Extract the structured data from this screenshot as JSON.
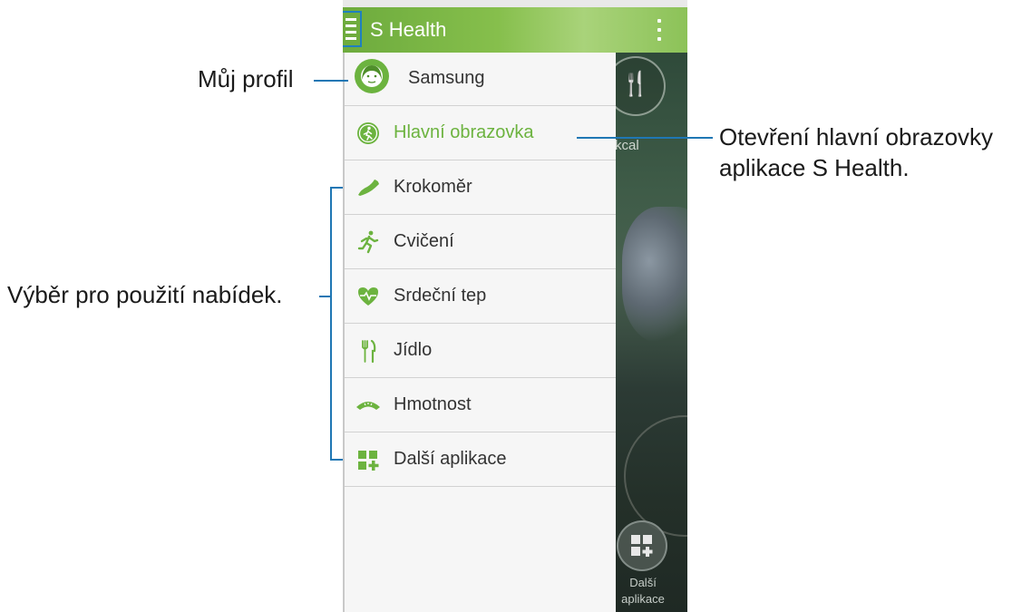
{
  "app": {
    "title": "S Health"
  },
  "drawer": {
    "items": [
      {
        "label": "Samsung",
        "icon": "profile-avatar-icon"
      },
      {
        "label": "Hlavní obrazovka",
        "icon": "home-icon",
        "active": true
      },
      {
        "label": "Krokoměr",
        "icon": "shoe-icon"
      },
      {
        "label": "Cvičení",
        "icon": "runner-icon"
      },
      {
        "label": "Srdeční tep",
        "icon": "heart-rate-icon"
      },
      {
        "label": "Jídlo",
        "icon": "fork-knife-icon"
      },
      {
        "label": "Hmotnost",
        "icon": "scale-icon"
      },
      {
        "label": "Další aplikace",
        "icon": "more-apps-icon"
      }
    ]
  },
  "background": {
    "kcal": "kcal",
    "more_apps_label": "Další aplikace"
  },
  "callouts": {
    "profile": "Můj profil",
    "home": "Otevření hlavní obrazovky aplikace S Health.",
    "menus": "Výběr pro použití nabídek."
  },
  "colors": {
    "accent_green": "#6cb33f",
    "callout_blue": "#1f77b4"
  }
}
